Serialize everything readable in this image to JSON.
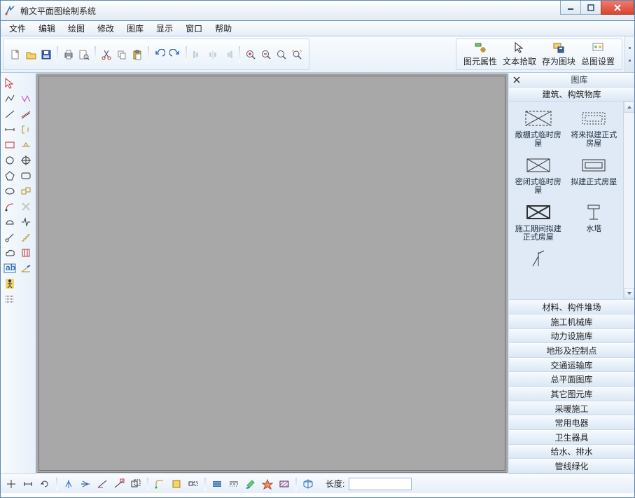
{
  "window": {
    "title": "翰文平面图绘制系统"
  },
  "menu": {
    "items": [
      "文件",
      "编辑",
      "绘图",
      "修改",
      "图库",
      "显示",
      "窗口",
      "帮助"
    ]
  },
  "toolbar_right": {
    "b0": "图元属性",
    "b1": "文本拾取",
    "b2": "存为图块",
    "b3": "总图设置"
  },
  "right_panel": {
    "title": "图库",
    "active_section": "建筑、构筑物库",
    "sections": [
      "材料、构件堆场",
      "施工机械库",
      "动力设施库",
      "地形及控制点",
      "交通运输库",
      "总平面图库",
      "其它图元库",
      "采暖施工",
      "常用电器",
      "卫生器具",
      "给水、排水",
      "管线绿化"
    ],
    "items": [
      {
        "label": "敞棚式临时房屋"
      },
      {
        "label": "将来拟建正式房屋"
      },
      {
        "label": "密闭式临时房屋"
      },
      {
        "label": "拟建正式房屋"
      },
      {
        "label": "施工期间拟建正式房屋"
      },
      {
        "label": "水塔"
      }
    ]
  },
  "statusbar": {
    "length_label": "长度:",
    "length_value": ""
  },
  "icons": {
    "new": "new-file",
    "open": "open-folder",
    "save": "floppy",
    "print": "printer",
    "print_preview": "print-preview",
    "cut": "scissors",
    "copy": "copy",
    "paste": "clipboard",
    "undo": "undo",
    "redo": "redo",
    "align_left": "align-left",
    "align_center": "align-center",
    "align_right": "align-right",
    "zoom_in": "zoom-in",
    "zoom_out": "zoom-out",
    "zoom": "zoom",
    "zoom_ext": "zoom-extents"
  }
}
